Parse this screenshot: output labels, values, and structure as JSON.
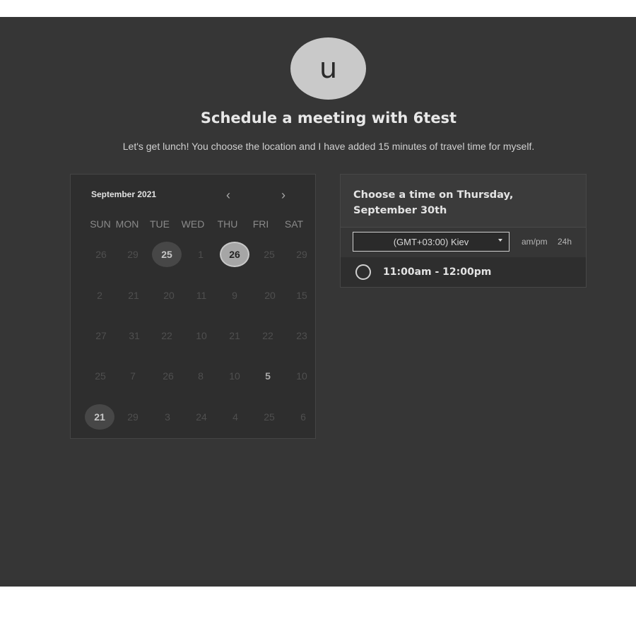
{
  "avatar": {
    "initial": "u"
  },
  "header": {
    "title": "Schedule a meeting with 6test",
    "subtitle": "Let's get lunch! You choose the location and I have added 15 minutes of travel time for myself."
  },
  "calendar": {
    "month_label": "September 2021",
    "prev_icon": "chevron-left-icon",
    "next_icon": "chevron-right-icon",
    "weekdays": [
      "SUN",
      "MON",
      "TUE",
      "WED",
      "THU",
      "FRI",
      "SAT"
    ],
    "weeks": [
      [
        "26",
        "29",
        "25",
        "1",
        "26",
        "25",
        "29"
      ],
      [
        "2",
        "21",
        "20",
        "11",
        "9",
        "20",
        "15"
      ],
      [
        "27",
        "31",
        "22",
        "10",
        "21",
        "22",
        "23"
      ],
      [
        "25",
        "7",
        "26",
        "8",
        "10",
        "5",
        "10"
      ],
      [
        "21",
        "29",
        "3",
        "24",
        "4",
        "25",
        "6"
      ]
    ]
  },
  "time_panel": {
    "title": "Choose a time on Thursday, September 30th",
    "timezone": "(GMT+03:00) Kiev",
    "format_ampm": "am/pm",
    "format_24h": "24h",
    "slots": [
      {
        "label": "11:00am - 12:00pm"
      }
    ]
  },
  "colors": {
    "app_background": "#363636",
    "page_background": "#ffffff",
    "calendar_background": "#2e2e2e",
    "avatar_background": "#c9c9c9"
  }
}
